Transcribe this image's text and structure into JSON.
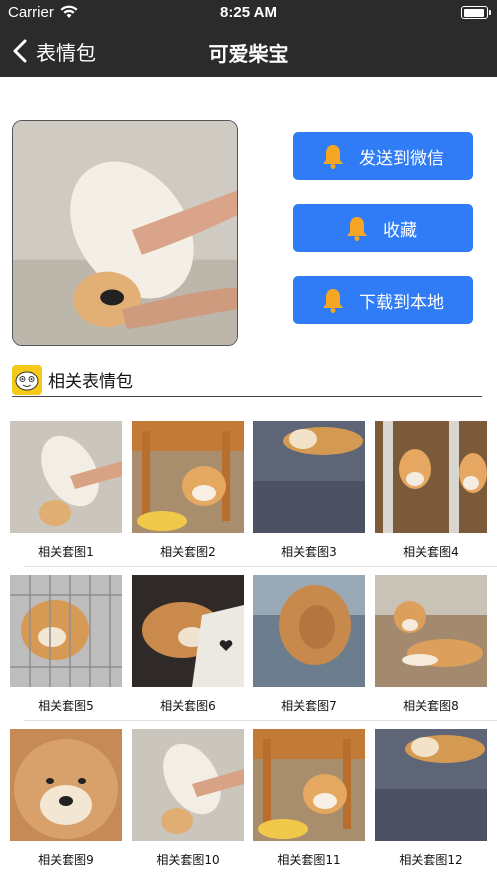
{
  "status_bar": {
    "carrier": "Carrier",
    "time": "8:25 AM"
  },
  "nav": {
    "back_label": "表情包",
    "title": "可爱柴宝"
  },
  "actions": [
    {
      "label": "发送到微信",
      "icon": "bell-icon"
    },
    {
      "label": "收藏",
      "icon": "bell-icon"
    },
    {
      "label": "下载到本地",
      "icon": "bell-icon"
    }
  ],
  "section": {
    "title": "相关表情包",
    "logo_icon": "sticker-face-icon"
  },
  "grid": {
    "items": [
      {
        "caption": "相关套图1"
      },
      {
        "caption": "相关套图2"
      },
      {
        "caption": "相关套图3"
      },
      {
        "caption": "相关套图4"
      },
      {
        "caption": "相关套图5"
      },
      {
        "caption": "相关套图6"
      },
      {
        "caption": "相关套图7"
      },
      {
        "caption": "相关套图8"
      },
      {
        "caption": "相关套图9"
      },
      {
        "caption": "相关套图10"
      },
      {
        "caption": "相关套图11"
      },
      {
        "caption": "相关套图12"
      }
    ]
  },
  "colors": {
    "nav_bg": "#2b2b2b",
    "accent": "#2f7cf6",
    "bell": "#f5a623",
    "logo_bg": "#f4c91a"
  }
}
